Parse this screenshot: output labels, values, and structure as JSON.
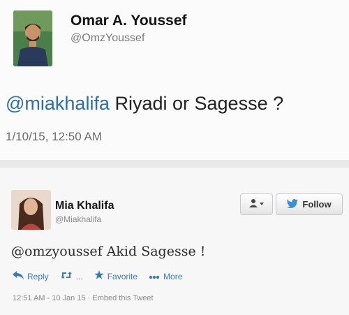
{
  "tweet1": {
    "author_name": "Omar A. Youssef",
    "handle": "@OmzYoussef",
    "mention": "@miakhalifa",
    "text": " Riyadi or Sagesse ?",
    "timestamp": "1/10/15, 12:50 AM"
  },
  "tweet2": {
    "author_name": "Mia Khalifa",
    "handle": "@Miakhalifa",
    "text": "@omzyoussef Akid Sagesse !",
    "follow_label": "Follow",
    "actions": {
      "reply": "Reply",
      "retweet": "...",
      "favorite": "Favorite",
      "more": "More"
    },
    "time": "12:51 AM - 10 Jan 15",
    "separator": " · ",
    "embed": "Embed this Tweet"
  },
  "icons": {
    "bird": "twitter-bird-icon",
    "user": "user-icon",
    "reply": "reply-arrow-icon",
    "retweet": "retweet-icon",
    "favorite": "star-icon",
    "more": "more-dots-icon"
  },
  "colors": {
    "link": "#2b6dad",
    "action": "#3a7ac0",
    "twitter_blue": "#3a8fd6"
  }
}
